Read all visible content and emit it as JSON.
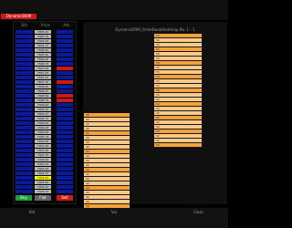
{
  "window": {
    "title": "DynamicDOM"
  },
  "ladder": {
    "headers": {
      "bid": "Bid",
      "price": "Price",
      "ask": "Ask"
    },
    "rows": [
      {
        "price": "7895.00",
        "ask": "",
        "bid": ""
      },
      {
        "price": "7895.25",
        "ask": "",
        "bid": ""
      },
      {
        "price": "7895.50",
        "ask": "",
        "bid": ""
      },
      {
        "price": "7895.75",
        "ask": "",
        "bid": ""
      },
      {
        "price": "7896.00",
        "ask": "",
        "bid": ""
      },
      {
        "price": "7896.25",
        "ask": "",
        "bid": ""
      },
      {
        "price": "7896.50",
        "ask": "",
        "bid": ""
      },
      {
        "price": "7896.75",
        "ask": "",
        "bid": ""
      },
      {
        "price": "7897.00",
        "ask": "",
        "bid": ""
      },
      {
        "price": "7897.25",
        "ask": "",
        "bid": ""
      },
      {
        "price": "7897.50",
        "ask": "",
        "bid": ""
      },
      {
        "price": "7897.75",
        "ask": "",
        "bid": ""
      },
      {
        "price": "7898.00",
        "ask": "",
        "bid": ""
      },
      {
        "price": "7898.25",
        "ask": "",
        "bid": ""
      },
      {
        "price": "7898.50",
        "ask": "",
        "bid": ""
      },
      {
        "price": "7898.75",
        "ask": "",
        "bid": ""
      },
      {
        "price": "7899.00",
        "ask": "",
        "bid": ""
      },
      {
        "price": "7899.25",
        "ask": "",
        "bid": ""
      },
      {
        "price": "7899.50",
        "ask": "",
        "bid": ""
      },
      {
        "price": "7899.75",
        "ask": "",
        "bid": ""
      },
      {
        "price": "7900.00",
        "ask": "",
        "bid": ""
      },
      {
        "price": "7900.25",
        "ask": "",
        "bid": ""
      },
      {
        "price": "7900.50",
        "ask": "",
        "bid": ""
      },
      {
        "price": "7900.75",
        "ask": "",
        "bid": ""
      },
      {
        "price": "7901.00",
        "ask": "",
        "bid": ""
      },
      {
        "price": "7901.25",
        "ask": "",
        "bid": ""
      },
      {
        "price": "7901.50",
        "ask": "",
        "bid": ""
      },
      {
        "price": "7901.75",
        "ask": "",
        "bid": ""
      },
      {
        "price": "7902.00",
        "ask": "",
        "bid": ""
      },
      {
        "price": "7902.25",
        "ask": "",
        "bid": ""
      },
      {
        "price": "7902.50",
        "ask": "",
        "bid": ""
      },
      {
        "price": "7902.75",
        "ask": "",
        "bid": ""
      },
      {
        "price": "7903.00",
        "ask": "",
        "bid": ""
      },
      {
        "price": "7903.25",
        "ask": "",
        "bid": ""
      },
      {
        "price": "7903.50",
        "ask": "",
        "bid": ""
      },
      {
        "price": "7903.75",
        "ask": "",
        "bid": ""
      }
    ],
    "last_price": "7903.00",
    "buttons": {
      "buy": "Buy",
      "flat": "Flat",
      "sell": "Sell"
    }
  },
  "heatmap": {
    "title": "DynamicDOM_OrderBookHeatmap No. 1 - 1",
    "upper_levels": [
      "55",
      "52",
      "52",
      "52",
      "60",
      "55",
      "55",
      "55",
      "55",
      "54",
      "52",
      "52",
      "50",
      "52",
      "52",
      "52",
      "52",
      "52",
      "52",
      "52",
      "52",
      "52",
      "52",
      "52",
      "52"
    ],
    "lower_levels": [
      "38",
      "40",
      "41",
      "40",
      "42",
      "40",
      "40",
      "40",
      "40",
      "40",
      "40",
      "40",
      "40",
      "40",
      "40",
      "40",
      "40",
      "40",
      "40",
      "40",
      "40"
    ]
  },
  "footer": {
    "tabs": [
      "Bid",
      "Vol",
      "Close"
    ]
  },
  "colors": {
    "bid_blue": "#0a1a9a",
    "ask_red": "#cc1a1a",
    "price_gray": "#b8b8b8",
    "last_yellow": "#ffff00",
    "heat_orange": "#f6a23a",
    "heat_light": "#fbc98a",
    "buy_green": "#1aa03a",
    "flat_gray": "#666666",
    "sell_red": "#d01a1a"
  }
}
